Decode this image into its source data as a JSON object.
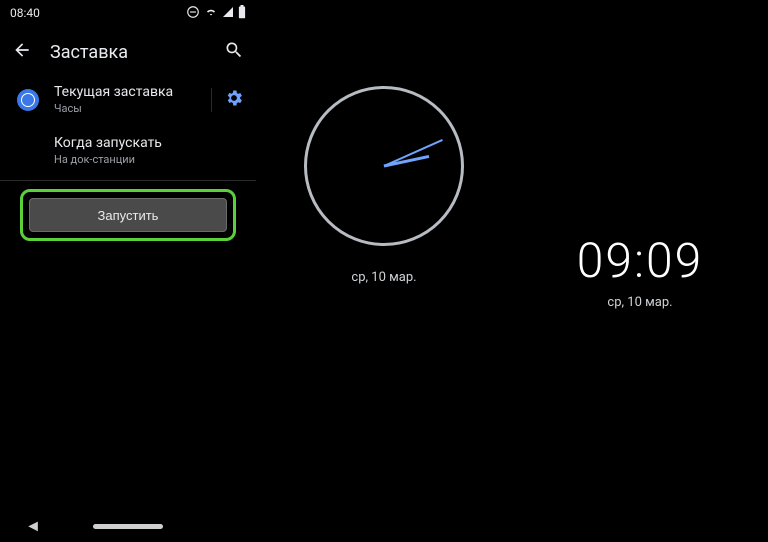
{
  "statusbar": {
    "time": "08:40"
  },
  "appbar": {
    "title": "Заставка"
  },
  "screensaver_row": {
    "title": "Текущая заставка",
    "subtitle": "Часы"
  },
  "when_row": {
    "title": "Когда запускать",
    "subtitle": "На док-станции"
  },
  "start_button": {
    "label": "Запустить"
  },
  "analog": {
    "date": "ср, 10 мар."
  },
  "digital": {
    "time": "09:09",
    "date": "ср, 10 мар."
  }
}
